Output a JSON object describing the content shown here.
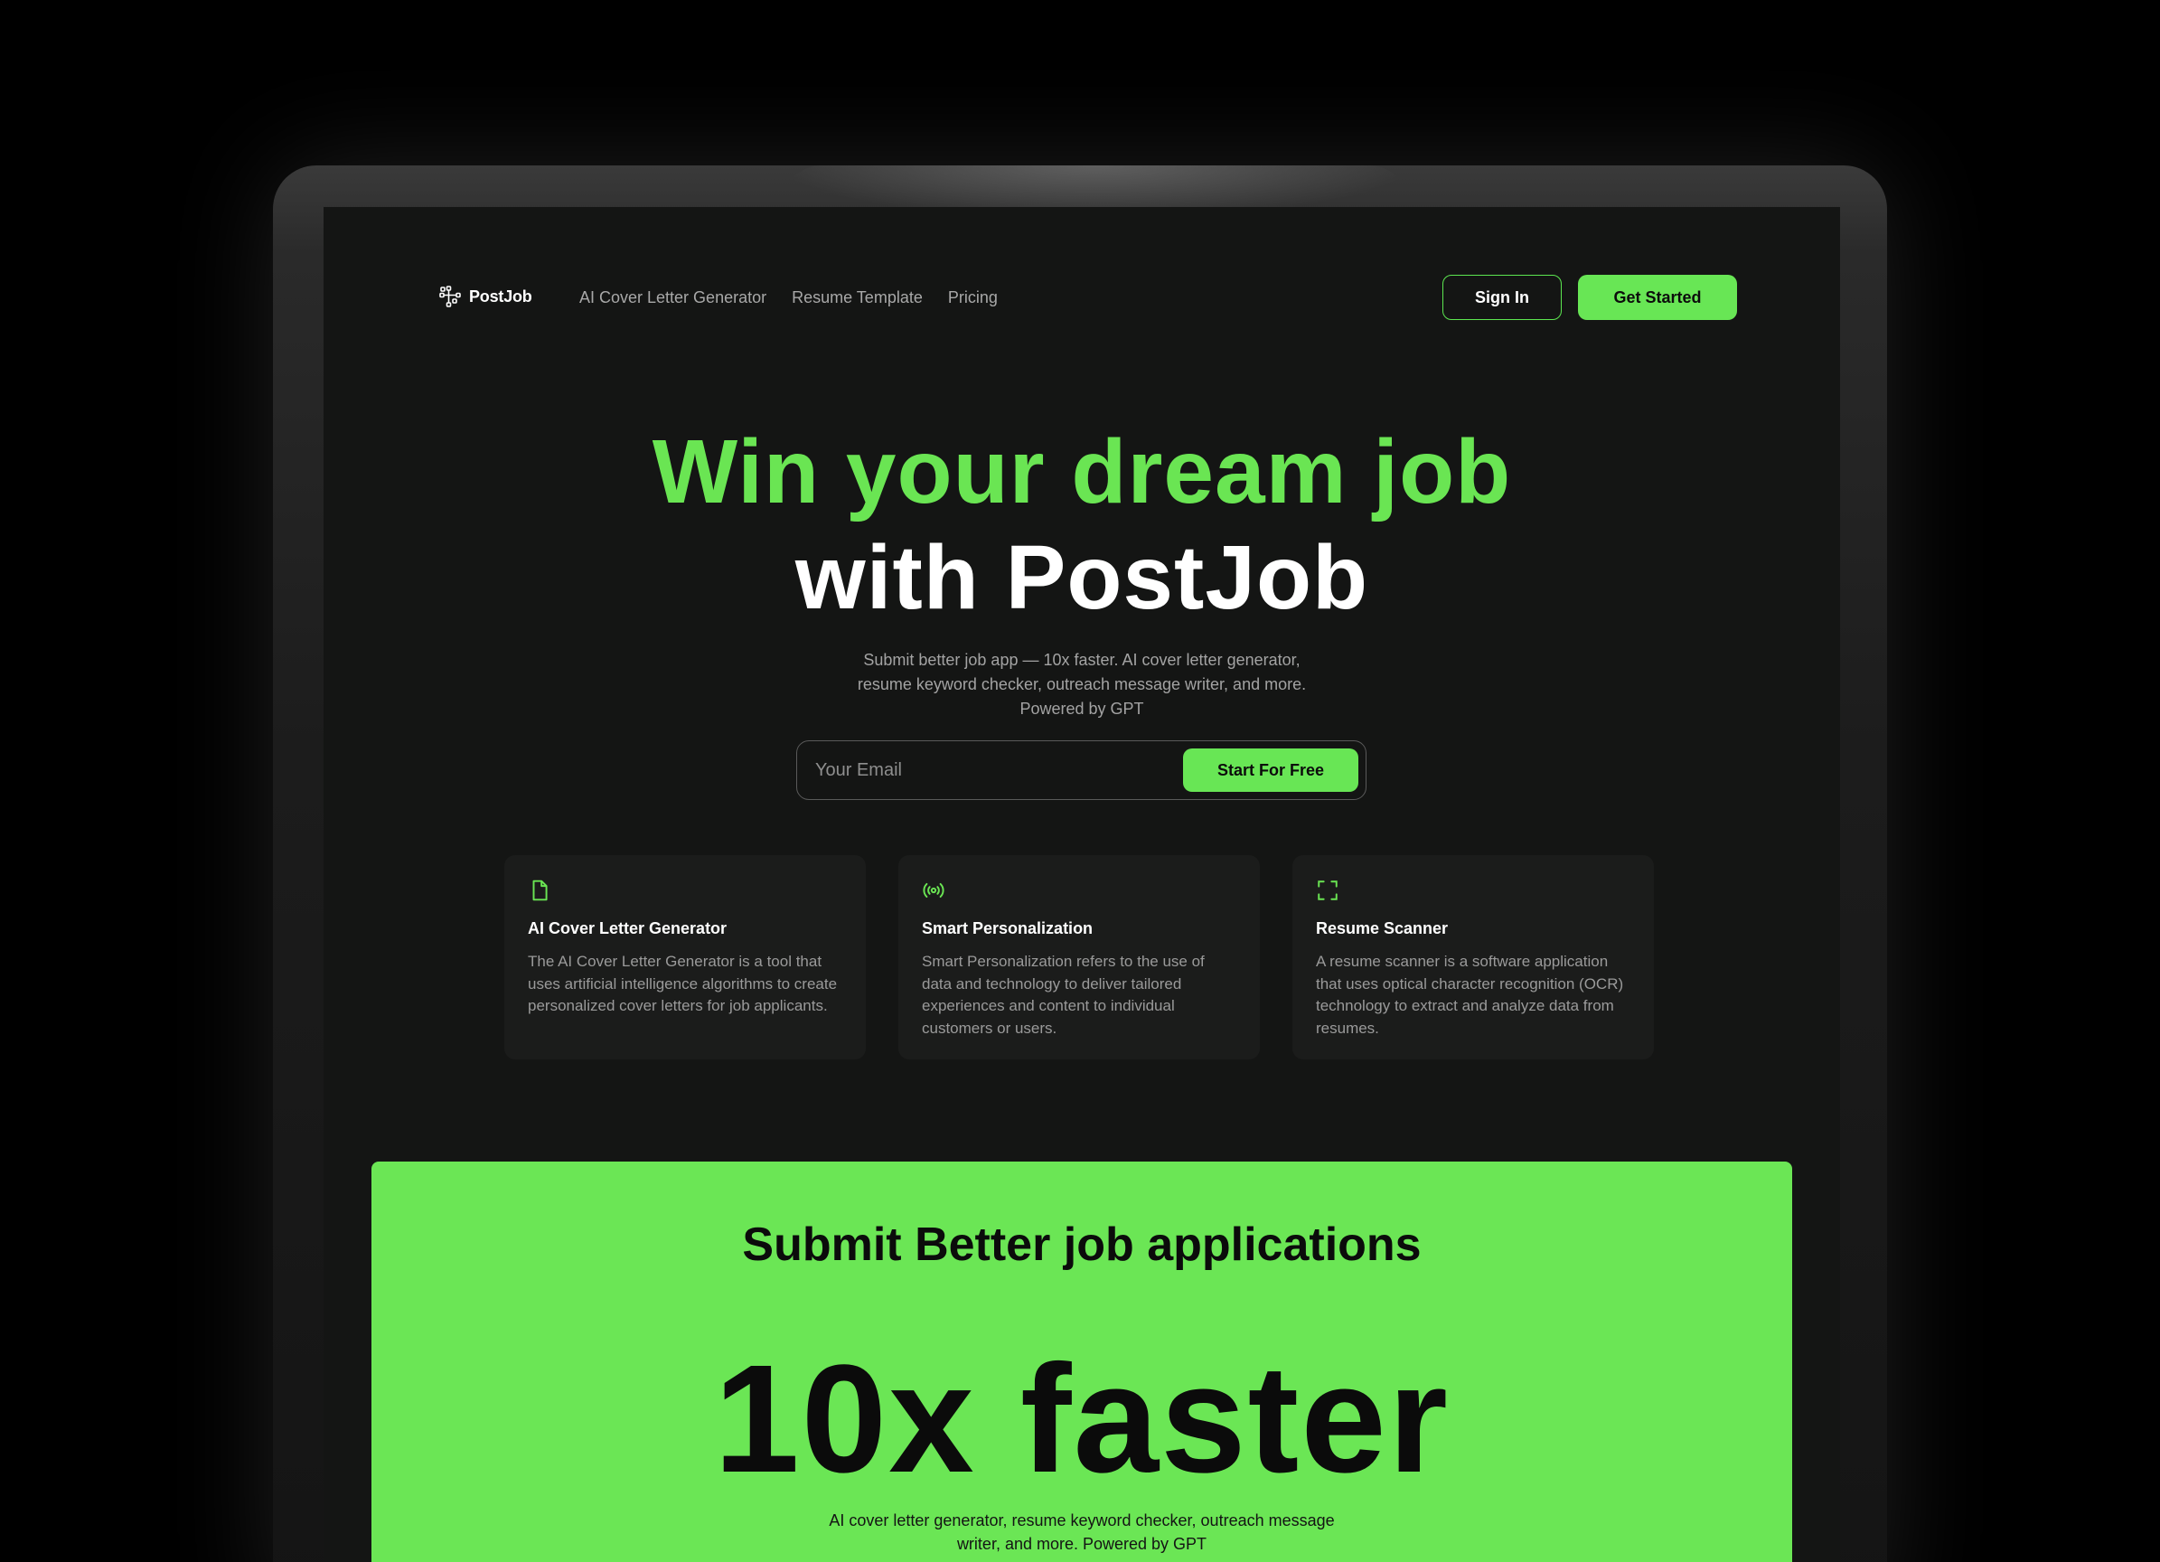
{
  "brand": {
    "name": "PostJob",
    "icon": "postjob-logo-icon"
  },
  "nav": {
    "links": [
      "AI Cover Letter Generator",
      "Resume Template",
      "Pricing"
    ],
    "sign_in": "Sign In",
    "get_started": "Get Started"
  },
  "hero": {
    "title_line1": "Win your dream job",
    "title_line2": "with PostJob",
    "subtitle": "Submit better job app — 10x faster. AI cover letter generator, resume keyword checker, outreach message writer, and more. Powered by GPT",
    "email_placeholder": "Your Email",
    "email_value": "",
    "cta_button": "Start For Free"
  },
  "features": [
    {
      "icon": "document-icon",
      "title": "AI Cover Letter Generator",
      "description": "The AI Cover Letter Generator is a tool that uses artificial intelligence algorithms to create personalized cover letters for job applicants."
    },
    {
      "icon": "broadcast-icon",
      "title": "Smart Personalization",
      "description": "Smart Personalization refers to the use of data and technology to deliver tailored experiences and content to individual customers or users."
    },
    {
      "icon": "scan-icon",
      "title": "Resume Scanner",
      "description": "A resume scanner is a software application that uses optical character recognition (OCR) technology to extract and analyze data from resumes."
    }
  ],
  "cta_section": {
    "title": "Submit Better job applications",
    "highlight": "10x faster",
    "subtitle": "AI cover letter generator, resume keyword checker, outreach message writer, and more. Powered by GPT"
  },
  "colors": {
    "accent": "#68e655",
    "background": "#141514",
    "card": "#1b1c1b",
    "text_muted": "#a3a3a3"
  }
}
